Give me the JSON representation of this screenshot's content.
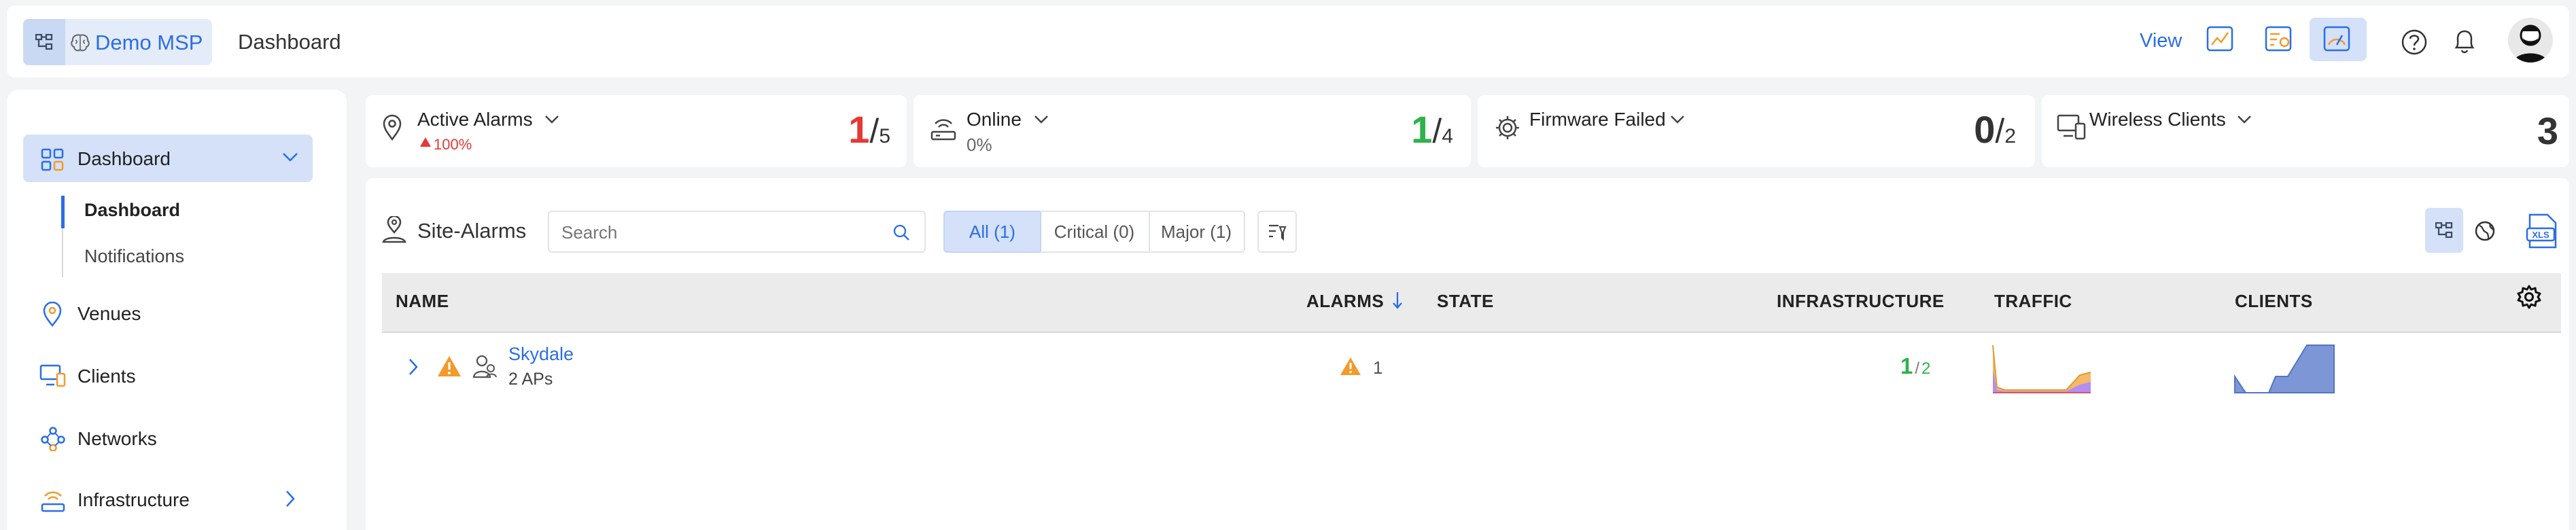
{
  "header": {
    "brand": "Demo MSP",
    "title": "Dashboard",
    "view_label": "View"
  },
  "sidebar": {
    "items": [
      {
        "label": "Dashboard"
      },
      {
        "label": "Venues"
      },
      {
        "label": "Clients"
      },
      {
        "label": "Networks"
      },
      {
        "label": "Infrastructure"
      }
    ],
    "subitems": [
      {
        "label": "Dashboard"
      },
      {
        "label": "Notifications"
      }
    ]
  },
  "kpis": [
    {
      "title": "Active Alarms",
      "big": "1",
      "slash": "/",
      "total": "5",
      "sub": "100%",
      "big_color": "#e53935"
    },
    {
      "title": "Online",
      "big": "1",
      "slash": "/",
      "total": "4",
      "sub": "0%",
      "big_color": "#2eb24a"
    },
    {
      "title": "Firmware Failed",
      "big": "0",
      "slash": "/",
      "total": "2",
      "sub": "",
      "big_color": "#333333"
    },
    {
      "title": "Wireless Clients",
      "big": "3",
      "sub": "",
      "big_color": "#333333"
    }
  ],
  "site_alarms": {
    "title": "Site-Alarms",
    "search_placeholder": "Search",
    "filters": [
      "All (1)",
      "Critical (0)",
      "Major (1)"
    ],
    "columns": [
      "NAME",
      "ALARMS",
      "STATE",
      "INFRASTRUCTURE",
      "TRAFFIC",
      "CLIENTS"
    ],
    "rows": [
      {
        "name": "Skydale",
        "sub": "2 APs",
        "alarms": "1",
        "infra_up": "1",
        "infra_sep": "/",
        "infra_total": "2"
      }
    ]
  },
  "colors": {
    "accent": "#2a6ee6",
    "selected_bg": "#d4e1f8",
    "alarm_red": "#e53935",
    "online_green": "#2eb24a",
    "warning_orange": "#f39a2b"
  }
}
